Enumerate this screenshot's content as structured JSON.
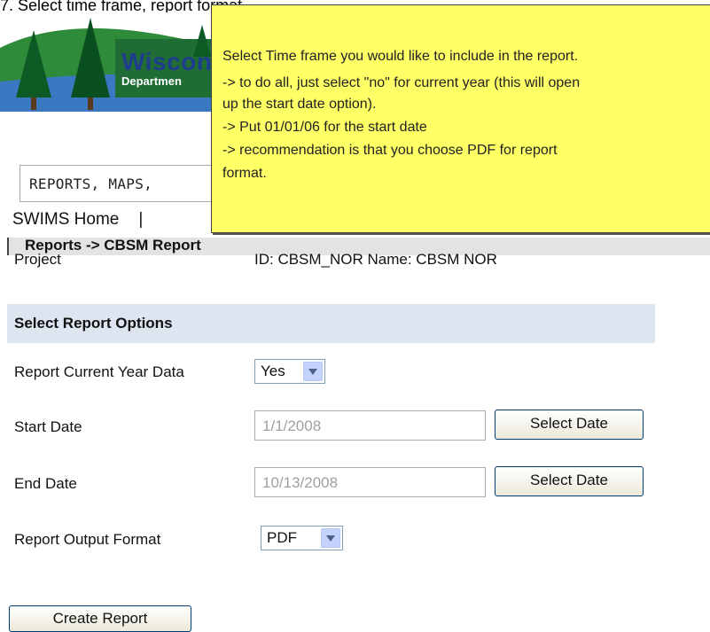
{
  "caption": "7. Select time frame, report format.",
  "header": {
    "logo_title": "Wiscons",
    "logo_subtitle": "Departmen"
  },
  "menu": {
    "label": "REPORTS, MAPS,",
    "nav_home": "SWIMS Home",
    "nav_separator": "|"
  },
  "tooltip": {
    "lines": [
      "Select Time frame you would like to include in the report.",
      "-> to do all, just select \"no\" for current year (this will open",
      "up the start date option).",
      "-> Put 01/01/06 for the start date",
      "-> recommendation is that you choose PDF for report",
      "format."
    ]
  },
  "section": {
    "title": "Reports -> CBSM Report"
  },
  "project": {
    "label": "Project",
    "value": "ID: CBSM_NOR Name: CBSM NOR"
  },
  "options": {
    "title": "Select Report Options",
    "current_year_label": "Report Current Year Data",
    "current_year_value": "Yes",
    "start_date_label": "Start Date",
    "start_date_value": "1/1/2008",
    "end_date_label": "End Date",
    "end_date_value": "10/13/2008",
    "select_date_label": "Select Date",
    "format_label": "Report Output Format",
    "format_value": "PDF",
    "create_button": "Create Report"
  },
  "colors": {
    "tooltip_bg": "#ffff66",
    "options_header_bg": "#dde6f0",
    "logo_blue": "#1e3d8c"
  },
  "icons": [
    "tree-logo-icon",
    "dropdown-arrow-icon"
  ]
}
